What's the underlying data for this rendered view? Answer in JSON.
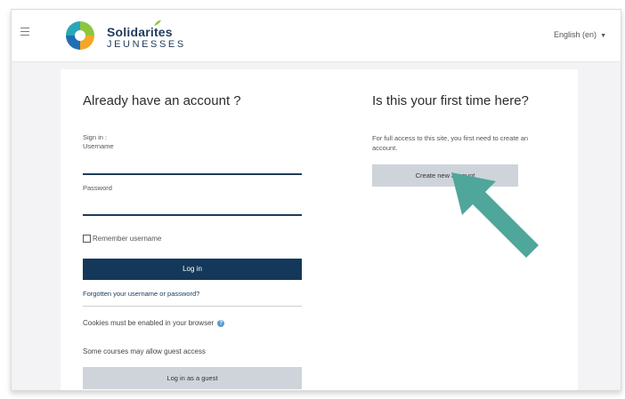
{
  "header": {
    "logo_title": "Solidarites",
    "logo_subtitle": "JEUNESSES",
    "language": "English (en)"
  },
  "login": {
    "heading": "Already have an account ?",
    "sign_in_label": "Sign in :",
    "username_label": "Username",
    "username_value": "",
    "password_label": "Password",
    "password_value": "",
    "remember_label": "Remember username",
    "login_button": "Log in",
    "forgot_link": "Forgotten your username or password?",
    "cookies_note": "Cookies must be enabled in your browser",
    "guest_note": "Some courses may allow guest access",
    "guest_button": "Log in as a guest"
  },
  "signup": {
    "heading": "Is this your first time here?",
    "description": "For full access to this site, you first need to create an account.",
    "create_button": "Create new account"
  },
  "colors": {
    "primary": "#14385a",
    "secondary_button": "#ced4da",
    "arrow": "#4fa69a",
    "logo_green": "#8cc63f",
    "logo_blue": "#1f6fb5",
    "logo_orange": "#f5a623"
  },
  "icons": {
    "menu": "hamburger-icon",
    "info": "info-icon",
    "dropdown": "caret-down-icon",
    "annotation": "arrow-pointer-icon"
  }
}
